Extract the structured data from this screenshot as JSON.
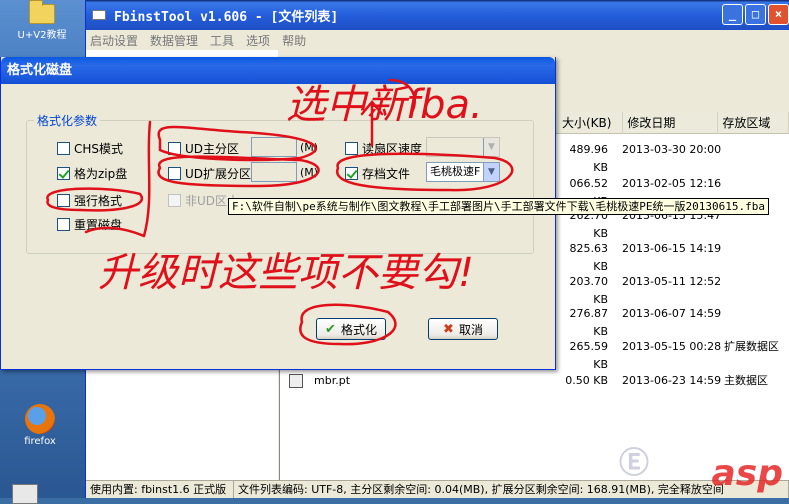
{
  "desktop": {
    "icons": [
      {
        "label": "U+V2教程",
        "icon": "folder-icon"
      },
      {
        "label": "firefox",
        "icon": "firefox-icon"
      }
    ]
  },
  "window": {
    "title": "FbinstTool v1.606 - [文件列表]",
    "controls": [
      "_",
      "□",
      "×"
    ],
    "menu": [
      "启动设置",
      "数据管理",
      "工具",
      "选项",
      "帮助"
    ]
  },
  "file_list": {
    "columns": [
      "大小(KB)",
      "修改日期",
      "存放区域"
    ],
    "rows": [
      {
        "size": "489.96 KB",
        "date": "2013-03-30 20:00",
        "area": ""
      },
      {
        "size": "066.52 KB",
        "date": "2013-02-05 12:16",
        "area": ""
      },
      {
        "size": "262.70 KB",
        "date": "2013-06-15 15:47",
        "area": ""
      },
      {
        "size": "825.63 KB",
        "date": "2013-06-15 14:19",
        "area": ""
      },
      {
        "size": "203.70 KB",
        "date": "2013-05-11 12:52",
        "area": ""
      },
      {
        "size": "276.87 KB",
        "date": "2013-06-07 14:59",
        "area": ""
      },
      {
        "size": "265.59 KB",
        "date": "2013-05-15 00:28",
        "area": "扩展数据区"
      },
      {
        "name": "mbr.pt",
        "size": "0.50 KB",
        "date": "2013-06-23 14:59",
        "area": "主数据区"
      }
    ]
  },
  "status": {
    "left": "使用内置: fbinst1.6 正式版",
    "right": "文件列表编码: UTF-8, 主分区剩余空间: 0.04(MB), 扩展分区剩余空间: 168.91(MB), 完全释放空间"
  },
  "dialog": {
    "title": "格式化磁盘",
    "group_label": "格式化参数",
    "chs_mode": "CHS模式",
    "format_zip": "格为zip盘",
    "force_format": "强行格式",
    "reset_disk": "重置磁盘",
    "ud_primary": "UD主分区",
    "ud_extended": "UD扩展分区",
    "non_ud": "非UD区大",
    "mb_unit": "(M)",
    "read_speed": "读扇区速度",
    "archive_file": "存档文件",
    "archive_value": "毛桃极速F",
    "ok_label": "格式化",
    "cancel_label": "取消",
    "checkbox_states": {
      "chs": false,
      "zip": true,
      "force": false,
      "reset": false,
      "primary": false,
      "extended": false,
      "non_ud": false,
      "speed": false,
      "archive": true
    }
  },
  "tooltip": "F:\\软件自制\\pe系统与制作\\图文教程\\手工部署图片\\手工部署文件下载\\毛桃极速PE统一版20130615.fba",
  "annotations": {
    "top": "选中新fba.",
    "middle": "升级时这些项不要勾!"
  },
  "watermark": "asp"
}
